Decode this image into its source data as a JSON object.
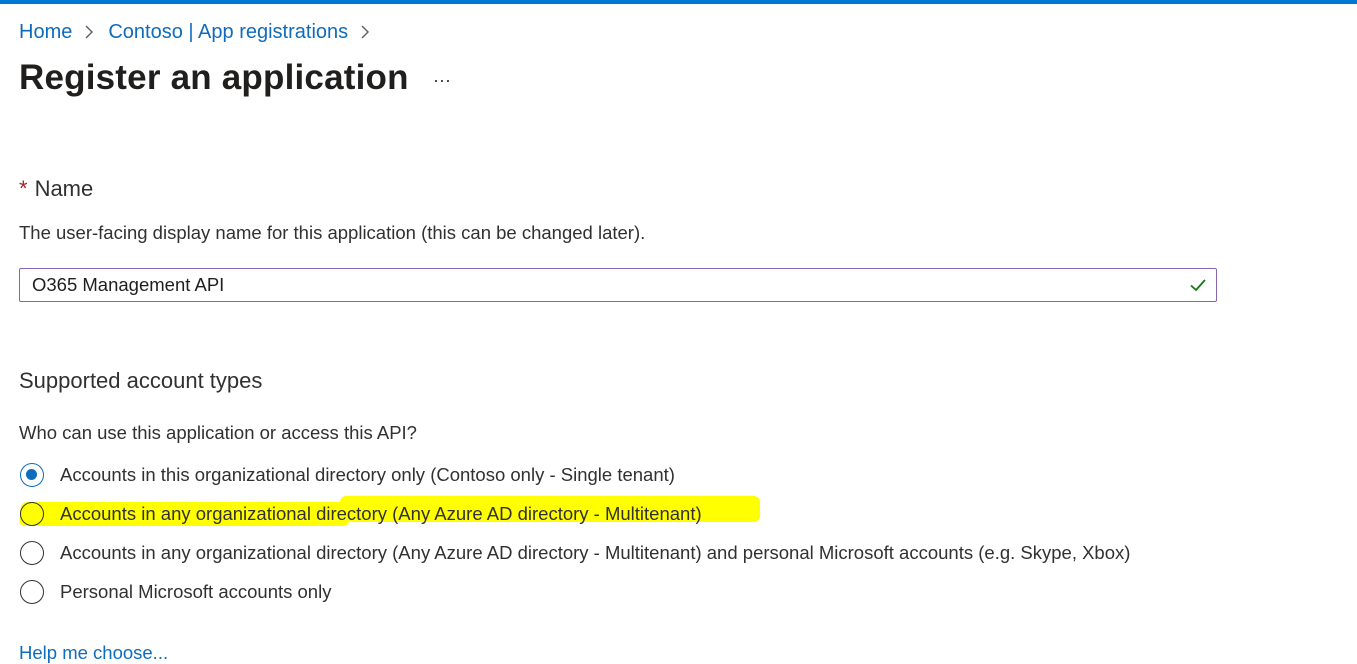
{
  "breadcrumb": {
    "items": [
      {
        "label": "Home"
      },
      {
        "label": "Contoso | App registrations"
      }
    ]
  },
  "page": {
    "title": "Register an application",
    "more_label": "···"
  },
  "name_section": {
    "required_mark": "*",
    "label": "Name",
    "description": "The user-facing display name for this application (this can be changed later).",
    "input_value": "O365 Management API",
    "valid": true
  },
  "account_types": {
    "title": "Supported account types",
    "question": "Who can use this application or access this API?",
    "options": [
      {
        "label": "Accounts in this organizational directory only (Contoso only - Single tenant)",
        "checked": true
      },
      {
        "label": "Accounts in any organizational directory (Any Azure AD directory - Multitenant)",
        "checked": false,
        "highlighted": true
      },
      {
        "label": "Accounts in any organizational directory (Any Azure AD directory - Multitenant) and personal Microsoft accounts (e.g. Skype, Xbox)",
        "checked": false
      },
      {
        "label": "Personal Microsoft accounts only",
        "checked": false
      }
    ]
  },
  "help": {
    "link_label": "Help me choose..."
  },
  "colors": {
    "accent": "#0078d4",
    "link": "#0f6cbd",
    "highlight": "#ffff00",
    "valid_check": "#107c10",
    "input_border": "#8764b8",
    "required": "#a4262c"
  },
  "icons": {
    "chevron": "chevron-right-icon",
    "valid": "checkmark-icon"
  }
}
